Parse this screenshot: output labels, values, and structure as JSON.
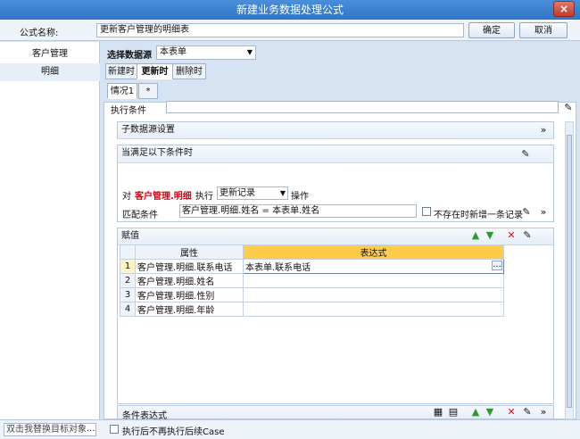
{
  "window": {
    "title": "新建业务数据处理公式",
    "close_glyph": "×"
  },
  "formula": {
    "name_label": "公式名称:",
    "name_value": "更新客户管理的明细表",
    "ok_label": "确定",
    "cancel_label": "取消"
  },
  "sidebar": {
    "items": [
      {
        "label": "客户管理"
      },
      {
        "label": "明细"
      }
    ],
    "search_placeholder": "双击我替换目标对象",
    "more_label": "..."
  },
  "source": {
    "label": "选择数据源",
    "value": "本表单"
  },
  "tabs": [
    {
      "label": "新建时"
    },
    {
      "label": "更新时"
    },
    {
      "label": "删除时"
    }
  ],
  "case_tabs": [
    {
      "label": "情况1"
    },
    {
      "label": "*"
    }
  ],
  "exec_condition": {
    "label": "执行条件",
    "value": ""
  },
  "sub_source": {
    "label": "子数据源设置"
  },
  "cond": {
    "title": "当满足以下条件时",
    "target_prefix": "对",
    "target": "客户管理.明细",
    "exec_label": "执行",
    "action": "更新记录",
    "op_label": "操作",
    "match_label": "匹配条件",
    "match_value": "客户管理.明细.姓名 = 本表单.姓名",
    "insert_label": "不存在时新增一条记录"
  },
  "assign": {
    "title": "赋值",
    "col_attr": "属性",
    "col_expr": "表达式",
    "rows": [
      {
        "num": "1",
        "attr": "客户管理.明细.联系电话",
        "expr": "本表单.联系电话"
      },
      {
        "num": "2",
        "attr": "客户管理.明细.姓名",
        "expr": ""
      },
      {
        "num": "3",
        "attr": "客户管理.明细.性别",
        "expr": ""
      },
      {
        "num": "4",
        "attr": "客户管理.明细.年龄",
        "expr": ""
      }
    ],
    "ellipsis": "..."
  },
  "cond_expr": {
    "label": "条件表达式"
  },
  "footer": {
    "stop_label": "执行后不再执行后续Case"
  },
  "colors": {
    "accent": "#2f74c6",
    "highlight": "#d9000f",
    "header_yellow": "#ffcc4a"
  }
}
